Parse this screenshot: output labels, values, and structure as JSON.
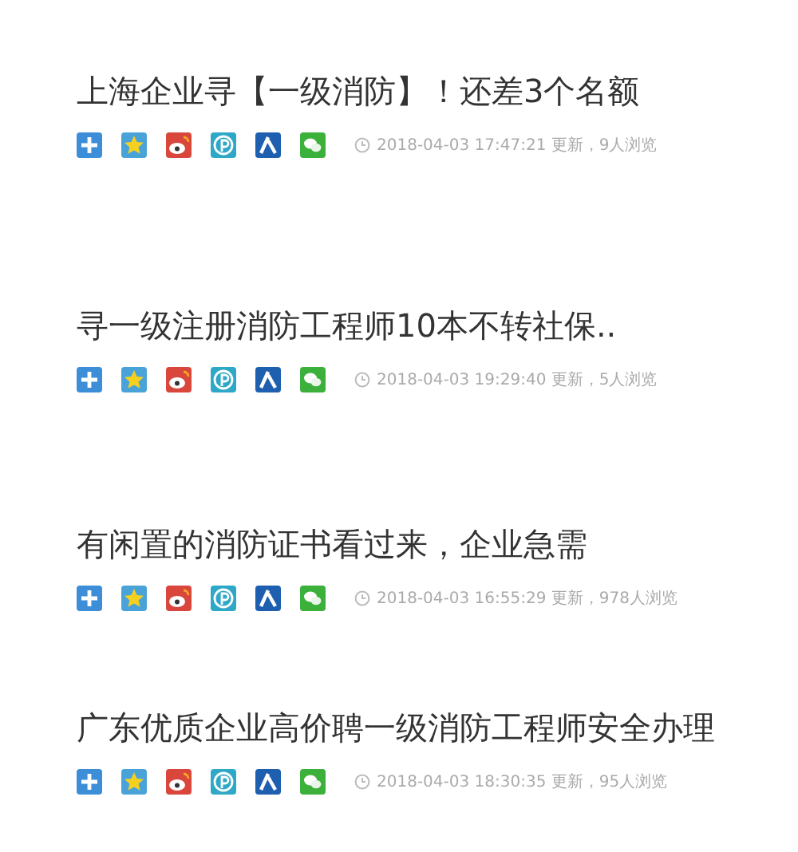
{
  "posts": [
    {
      "title": "上海企业寻【一级消防】！还差3个名额",
      "meta": "2018-04-03 17:47:21 更新，9人浏览"
    },
    {
      "title": "寻一级注册消防工程师10本不转社保..",
      "meta": "2018-04-03 19:29:40 更新，5人浏览"
    },
    {
      "title": "有闲置的消防证书看过来，企业急需",
      "meta": "2018-04-03 16:55:29 更新，978人浏览"
    },
    {
      "title": "广东优质企业高价聘一级消防工程师安全办理",
      "meta": "2018-04-03 18:30:35 更新，95人浏览"
    }
  ]
}
